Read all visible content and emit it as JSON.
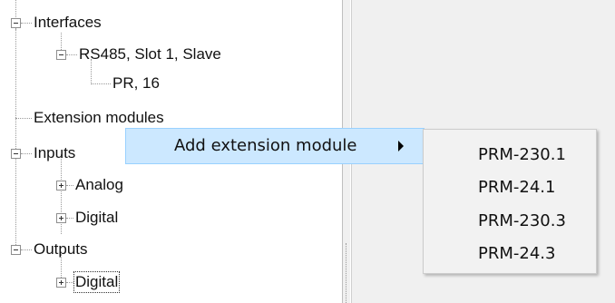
{
  "tree": {
    "interfaces": "Interfaces",
    "rs485": "RS485, Slot 1, Slave",
    "pr": "PR, 16",
    "extension_modules": "Extension modules",
    "inputs": "Inputs",
    "inputs_analog": "Analog",
    "inputs_digital": "Digital",
    "outputs": "Outputs",
    "outputs_digital": "Digital"
  },
  "context_menu": {
    "add_extension_module": "Add extension module"
  },
  "submenu": {
    "items": [
      "PRM-230.1",
      "PRM-24.1",
      "PRM-230.3",
      "PRM-24.3"
    ]
  },
  "colors": {
    "menu_highlight": "#cce8ff",
    "menu_highlight_border": "#99d1ff",
    "pane_background": "#f0f0f0"
  }
}
